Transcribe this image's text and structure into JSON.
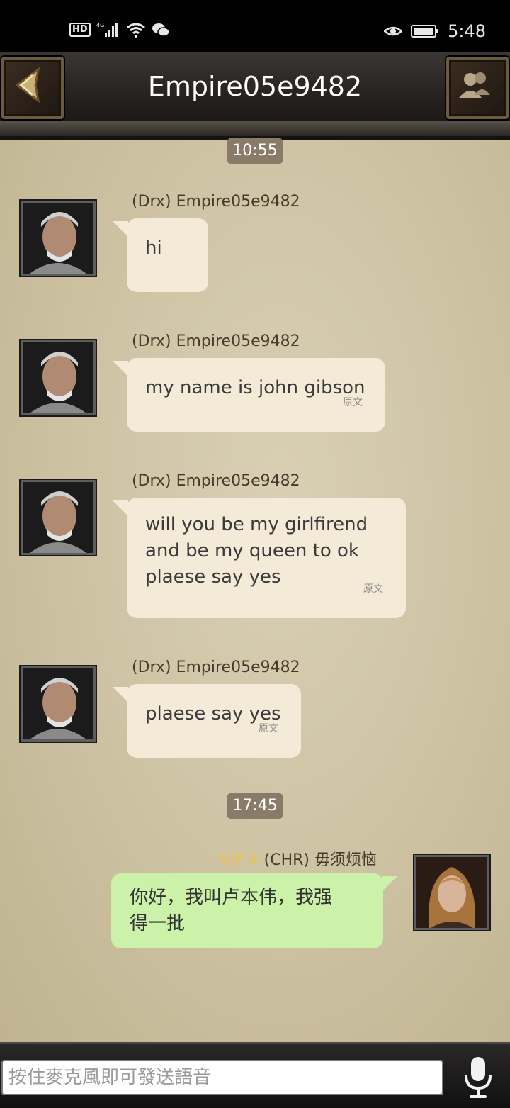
{
  "status_bar": {
    "hd": "HD",
    "network": "4G",
    "time": "5:48",
    "icons": [
      "signal-icon",
      "wifi-icon",
      "wechat-icon",
      "eye-icon",
      "battery-icon"
    ]
  },
  "header": {
    "title": "Empire05e9482",
    "back_icon": "back-arrow-icon",
    "friends_icon": "friends-icon"
  },
  "chat": {
    "timestamps": [
      "10:55",
      "17:45"
    ],
    "messages": [
      {
        "side": "left",
        "sender": "(Drx) Empire05e9482",
        "text": "hi",
        "original_label": ""
      },
      {
        "side": "left",
        "sender": "(Drx) Empire05e9482",
        "text": "my name is john gibson",
        "original_label": "原文"
      },
      {
        "side": "left",
        "sender": "(Drx) Empire05e9482",
        "lines": [
          "will you be my girlfirend",
          "and be my queen to ok",
          "plaese say yes"
        ],
        "original_label": "原文"
      },
      {
        "side": "left",
        "sender": "(Drx) Empire05e9482",
        "text": "plaese say yes",
        "original_label": "原文"
      },
      {
        "side": "right",
        "vip": "VIP 4",
        "sender": "(CHR) 毋须烦恼",
        "lines": [
          "你好，我叫卢本伟，我强",
          "得一批"
        ]
      }
    ]
  },
  "input": {
    "placeholder": "按住麥克風即可發送語音",
    "mic_icon": "microphone-icon"
  },
  "colors": {
    "parchment": "#d4c9ab",
    "incoming_bubble": "#f4ead8",
    "outgoing_bubble": "#ccf1a9",
    "vip": "#f0c24d",
    "timestamp_pill": "#8a7b68"
  }
}
